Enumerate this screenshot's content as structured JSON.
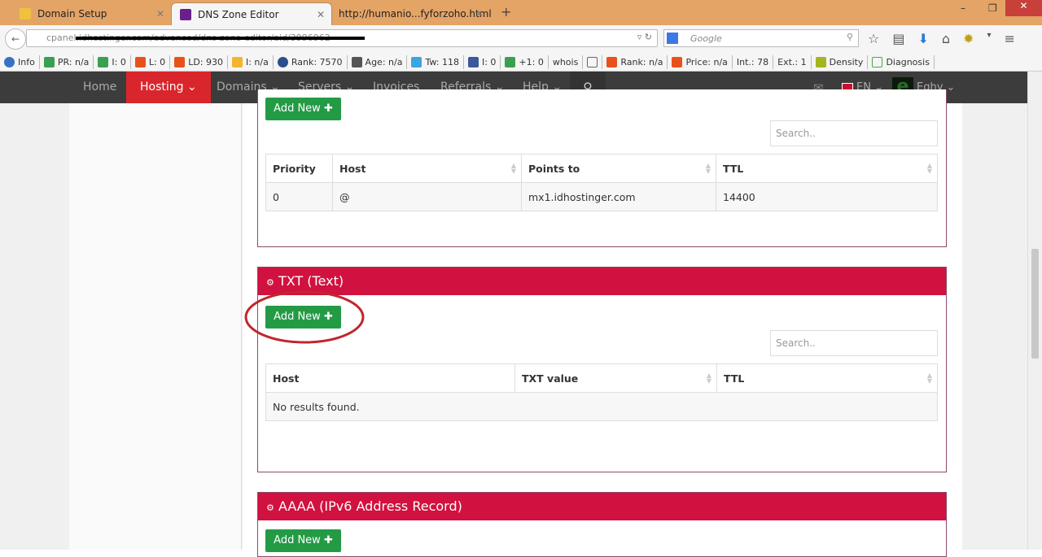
{
  "browser": {
    "tabs": [
      {
        "label": "Domain Setup"
      },
      {
        "label": "DNS Zone Editor"
      },
      {
        "label": "http://humanio...fyforzoho.html"
      }
    ],
    "url": "cpanel.idhostinger.com/advanced/dns-zone-editor/aid/3996962",
    "search_placeholder": "Google",
    "bookmarks": [
      "Info",
      "PR: n/a",
      "I: 0",
      "L: 0",
      "LD: 930",
      "I: n/a",
      "Rank: 7570",
      "Age: n/a",
      "Tw: 118",
      "I: 0",
      "+1: 0",
      "whois",
      "",
      "Rank: n/a",
      "Price: n/a",
      "Int.: 78",
      "Ext.: 1",
      "Density",
      "Diagnosis"
    ]
  },
  "nav": {
    "items": [
      {
        "label": "Home"
      },
      {
        "label": "Hosting ⌄"
      },
      {
        "label": "Domains ⌄"
      },
      {
        "label": "Servers ⌄"
      },
      {
        "label": "Invoices"
      },
      {
        "label": "Referrals ⌄"
      },
      {
        "label": "Help ⌄"
      }
    ],
    "lang": "EN ⌄",
    "user": "Eghy ⌄",
    "accent": "#d9262c"
  },
  "mx": {
    "add_label": "Add New ✚",
    "search_placeholder": "Search..",
    "columns": [
      "Priority",
      "Host",
      "Points to",
      "TTL"
    ],
    "rows": [
      [
        "0",
        "@",
        "mx1.idhostinger.com",
        "14400"
      ]
    ]
  },
  "txt": {
    "title": "TXT (Text)",
    "add_label": "Add New ✚",
    "search_placeholder": "Search..",
    "columns": [
      "Host",
      "TXT value",
      "TTL"
    ],
    "empty": "No results found."
  },
  "aaaa": {
    "title": "AAAA (IPv6 Address Record)",
    "add_label": "Add New ✚"
  },
  "colors": {
    "panel_header": "#d1113f",
    "add_button": "#239b45",
    "annotation": "#c0262c"
  }
}
